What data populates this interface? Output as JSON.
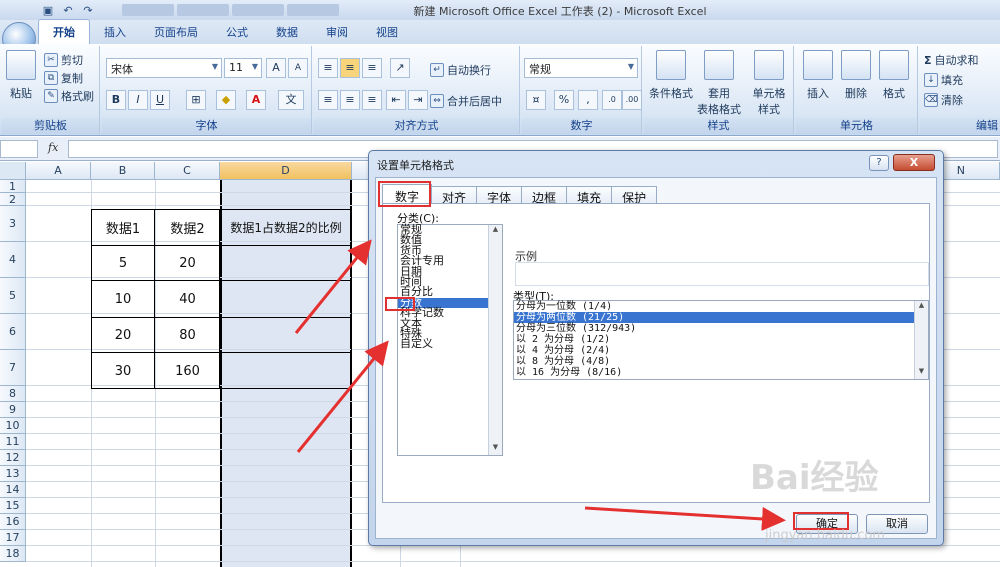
{
  "window": {
    "title": "新建 Microsoft Office Excel 工作表 (2) - Microsoft Excel"
  },
  "ribbon": {
    "tabs": [
      "开始",
      "插入",
      "页面布局",
      "公式",
      "数据",
      "审阅",
      "视图"
    ],
    "clipboard": {
      "paste": "粘贴",
      "cut": "剪切",
      "copy": "复制",
      "format_painter": "格式刷",
      "label": "剪贴板"
    },
    "font": {
      "name": "宋体",
      "size": "11",
      "label": "字体",
      "bold": "B",
      "italic": "I",
      "underline": "U",
      "grow": "A",
      "shrink": "A"
    },
    "alignment": {
      "wrap": "自动换行",
      "merge": "合并后居中",
      "label": "对齐方式"
    },
    "number": {
      "format": "常规",
      "percent": "%",
      "comma": ",",
      "label": "数字"
    },
    "styles": {
      "conditional": "条件格式",
      "table": "套用\n表格格式",
      "cell": "单元格\n样式",
      "label": "样式"
    },
    "cells": {
      "insert": "插入",
      "delete": "删除",
      "format": "格式",
      "label": "单元格"
    },
    "editing": {
      "autosum": "自动求和",
      "fill": "填充",
      "clear": "清除",
      "label": "编辑"
    }
  },
  "formula_bar": {
    "fx": "fx",
    "value": ""
  },
  "sheet": {
    "columns": [
      "A",
      "B",
      "C",
      "D",
      "N"
    ],
    "rows": [
      "1",
      "2",
      "3",
      "4",
      "5",
      "6",
      "7",
      "8",
      "9",
      "10",
      "11",
      "12",
      "13",
      "14",
      "15",
      "16",
      "17",
      "18"
    ],
    "table": {
      "header": [
        "数据1",
        "数据2",
        "数据1占数据2的比例"
      ],
      "rows": [
        [
          "5",
          "20"
        ],
        [
          "10",
          "40"
        ],
        [
          "20",
          "80"
        ],
        [
          "30",
          "160"
        ]
      ]
    }
  },
  "dialog": {
    "title": "设置单元格格式",
    "help": "?",
    "close": "X",
    "tabs": [
      "数字",
      "对齐",
      "字体",
      "边框",
      "填充",
      "保护"
    ],
    "category_label": "分类(C):",
    "categories": [
      "常规",
      "数值",
      "货币",
      "会计专用",
      "日期",
      "时间",
      "百分比",
      "分数",
      "科学记数",
      "文本",
      "特殊",
      "自定义"
    ],
    "selected_category": "分数",
    "sample_label": "示例",
    "type_label": "类型(T):",
    "types": [
      "分母为一位数 (1/4)",
      "分母为两位数 (21/25)",
      "分母为三位数 (312/943)",
      "以 2 为分母 (1/2)",
      "以 4 为分母 (2/4)",
      "以 8 为分母 (4/8)",
      "以 16 为分母 (8/16)"
    ],
    "selected_type": "分母为两位数 (21/25)",
    "ok": "确定",
    "cancel": "取消"
  },
  "watermark": {
    "brand": "Bai",
    "brand2": "经验",
    "url": "jingyan.baidu.com"
  }
}
